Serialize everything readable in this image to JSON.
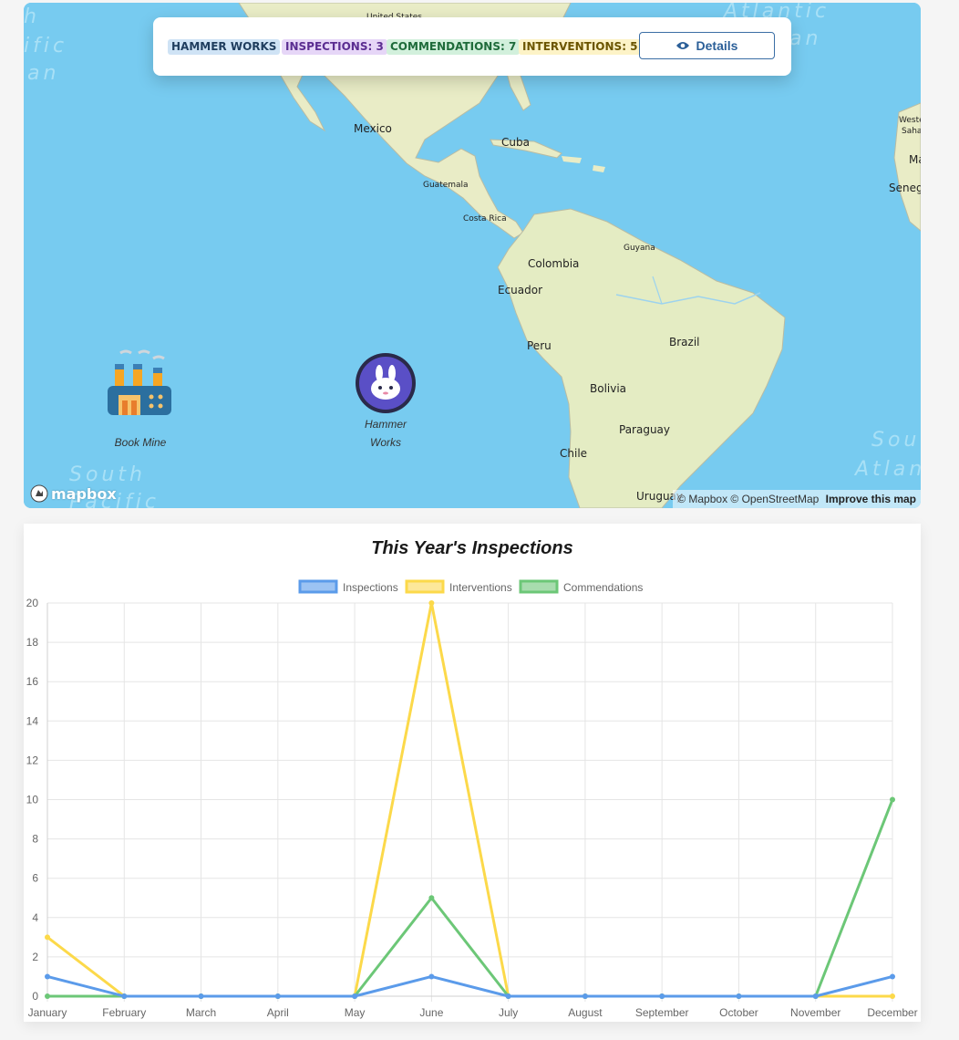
{
  "map": {
    "ocean_labels": {
      "atlantic_top": "Atlantic",
      "atlantic_top_2": "an",
      "pacific_left_1": "ific",
      "pacific_left_2": "an",
      "pacific_left_0": "h",
      "south_pacific_1": "South",
      "south_pacific_2": "Pacific",
      "south_atlantic_1": "Sou",
      "south_atlantic_2": "Atlan"
    },
    "countries": {
      "united_states": "United States",
      "mexico": "Mexico",
      "cuba": "Cuba",
      "guatemala": "Guatemala",
      "costa_rica": "Costa Rica",
      "guyana": "Guyana",
      "colombia": "Colombia",
      "ecuador": "Ecuador",
      "peru": "Peru",
      "brazil": "Brazil",
      "bolivia": "Bolivia",
      "paraguay": "Paraguay",
      "chile": "Chile",
      "uruguay": "Uruguay",
      "western_sahara_1": "Weste",
      "western_sahara_2": "Saha",
      "mauritania": "Ma",
      "senegal": "Seneg"
    },
    "markers": [
      {
        "label": "Book Mine",
        "icon": "factory-icon"
      },
      {
        "label_line1": "Hammer",
        "label_line2": "Works",
        "icon": "bunny-icon"
      }
    ],
    "logo": "mapbox",
    "attribution": "© Mapbox © OpenStreetMap",
    "improve": "Improve this map"
  },
  "info_panel": {
    "site": "HAMMER WORKS",
    "inspections": "INSPECTIONS: 3",
    "commendations": "COMMENDATIONS: 7",
    "interventions": "INTERVENTIONS: 5",
    "details_label": "Details",
    "details_icon": "eye-icon",
    "colors": {
      "site_bg": "#cfe3f5",
      "site_fg": "#1f3d5e",
      "insp_bg": "#e6d6f7",
      "insp_fg": "#5b2d91",
      "comm_bg": "#d2f0dc",
      "comm_fg": "#1e6b3a",
      "intv_bg": "#fdf3c7",
      "intv_fg": "#6b5500"
    }
  },
  "chart": {
    "title": "This Year's Inspections"
  },
  "chart_data": {
    "type": "line",
    "title": "This Year's Inspections",
    "categories": [
      "January",
      "February",
      "March",
      "April",
      "May",
      "June",
      "July",
      "August",
      "September",
      "October",
      "November",
      "December"
    ],
    "ylim": [
      0,
      20
    ],
    "yticks": [
      0,
      2,
      4,
      6,
      8,
      10,
      12,
      14,
      16,
      18,
      20
    ],
    "grid": true,
    "legend_position": "top",
    "series": [
      {
        "name": "Inspections",
        "color": "#5b9bea",
        "fill": "#9cc3f3",
        "values": [
          1,
          0,
          0,
          0,
          0,
          1,
          0,
          0,
          0,
          0,
          0,
          1
        ]
      },
      {
        "name": "Interventions",
        "color": "#fcd94a",
        "fill": "#fde89a",
        "values": [
          3,
          0,
          0,
          0,
          0,
          20,
          0,
          0,
          0,
          0,
          0,
          0
        ]
      },
      {
        "name": "Commendations",
        "color": "#6cc777",
        "fill": "#a8dcae",
        "values": [
          0,
          0,
          0,
          0,
          0,
          5,
          0,
          0,
          0,
          0,
          0,
          10
        ]
      }
    ]
  }
}
